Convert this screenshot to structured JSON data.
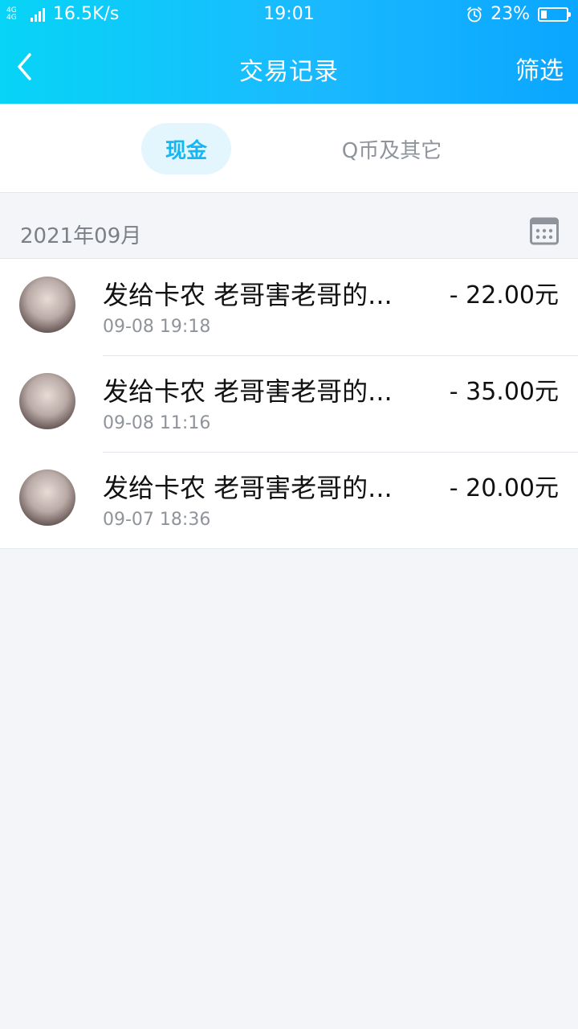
{
  "status_bar": {
    "network": "4G 4G",
    "speed": "16.5K/s",
    "time": "19:01",
    "battery": "23%",
    "battery_level": 0.23
  },
  "nav": {
    "title": "交易记录",
    "filter_label": "筛选"
  },
  "tabs": [
    {
      "label": "现金",
      "active": true
    },
    {
      "label": "Q币及其它",
      "active": false
    }
  ],
  "month": "2021年09月",
  "transactions": [
    {
      "title": "发给卡农 老哥害老哥的...",
      "time": "09-08 19:18",
      "amount": "- 22.00元"
    },
    {
      "title": "发给卡农 老哥害老哥的...",
      "time": "09-08 11:16",
      "amount": "- 35.00元"
    },
    {
      "title": "发给卡农 老哥害老哥的...",
      "time": "09-07 18:36",
      "amount": "- 20.00元"
    }
  ],
  "colors": {
    "accent": "#12b7f5",
    "header_start": "#07d4f6",
    "header_end": "#0aa6ff",
    "background": "#f3f5f9"
  }
}
